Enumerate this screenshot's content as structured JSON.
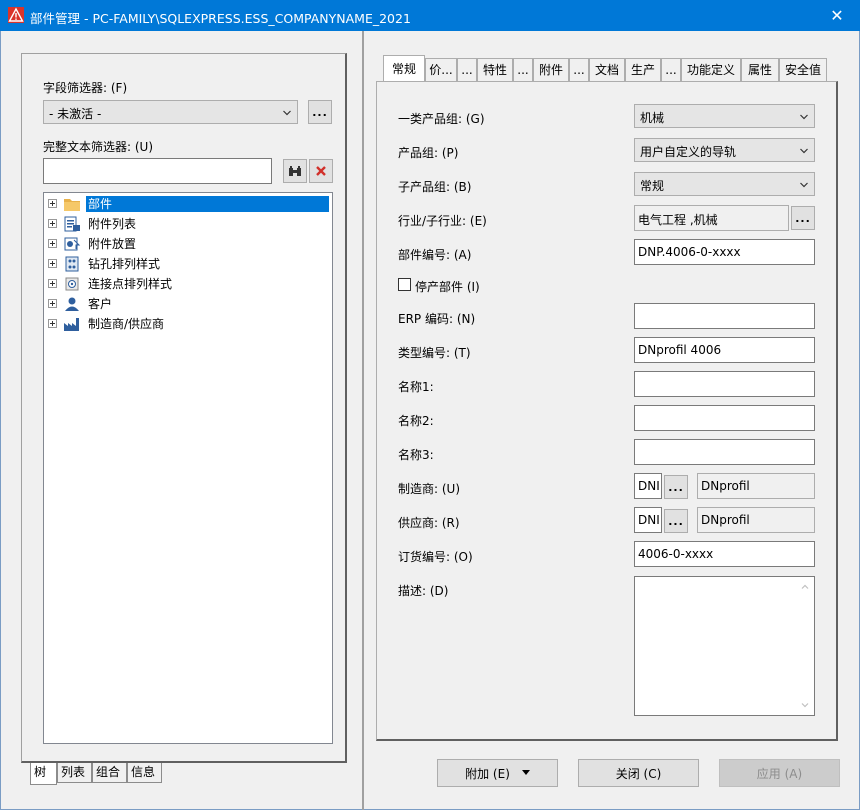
{
  "window": {
    "title": "部件管理 - PC-FAMILY\\SQLEXPRESS.ESS_COMPANYNAME_2021",
    "close_glyph": "✕",
    "accent": "#0078d7"
  },
  "left": {
    "field_filter_label": "字段筛选器: (F)",
    "field_filter_value": "- 未激活 -",
    "field_filter_more": "...",
    "fulltext_filter_label": "完整文本筛选器: (U)",
    "fulltext_value": "",
    "tree": [
      {
        "label": "部件",
        "icon": "folder-icon",
        "selected": true
      },
      {
        "label": "附件列表",
        "icon": "accessory-list-icon",
        "selected": false
      },
      {
        "label": "附件放置",
        "icon": "accessory-placement-icon",
        "selected": false
      },
      {
        "label": "钻孔排列样式",
        "icon": "drilling-pattern-icon",
        "selected": false
      },
      {
        "label": "连接点排列样式",
        "icon": "connection-point-pattern-icon",
        "selected": false
      },
      {
        "label": "客户",
        "icon": "customer-icon",
        "selected": false
      },
      {
        "label": "制造商/供应商",
        "icon": "factory-icon",
        "selected": false
      }
    ],
    "bottom_tabs": [
      "树",
      "列表",
      "组合",
      "信息"
    ]
  },
  "right": {
    "tabs": [
      "常规",
      "价...",
      "...",
      "特性",
      "...",
      "附件",
      "...",
      "文档",
      "生产",
      "...",
      "功能定义",
      "属性",
      "安全值"
    ],
    "fields": {
      "product_group_1_label": "一类产品组: (G)",
      "product_group_1_value": "机械",
      "product_group_label": "产品组: (P)",
      "product_group_value": "用户自定义的导轨",
      "sub_product_group_label": "子产品组: (B)",
      "sub_product_group_value": "常规",
      "industry_label": "行业/子行业: (E)",
      "industry_value": "电气工程 ,机械",
      "industry_more": "...",
      "part_number_label": "部件编号: (A)",
      "part_number_value": "DNP.4006-0-xxxx",
      "discontinued_label": "停产部件 (I)",
      "erp_label": "ERP 编码: (N)",
      "erp_value": "",
      "type_number_label": "类型编号: (T)",
      "type_number_value": "DNprofil 4006",
      "name1_label": "名称1:",
      "name1_value": "",
      "name2_label": "名称2:",
      "name2_value": "",
      "name3_label": "名称3:",
      "name3_value": "",
      "manufacturer_label": "制造商: (U)",
      "manufacturer_code": "DNI",
      "manufacturer_more": "...",
      "manufacturer_name": "DNprofil",
      "supplier_label": "供应商: (R)",
      "supplier_code": "DNI",
      "supplier_more": "...",
      "supplier_name": "DNprofil",
      "order_number_label": "订货编号: (O)",
      "order_number_value": "4006-0-xxxx",
      "description_label": "描述: (D)",
      "description_value": ""
    }
  },
  "buttons": {
    "add": "附加 (E)",
    "close": "关闭 (C)",
    "apply": "应用 (A)"
  }
}
